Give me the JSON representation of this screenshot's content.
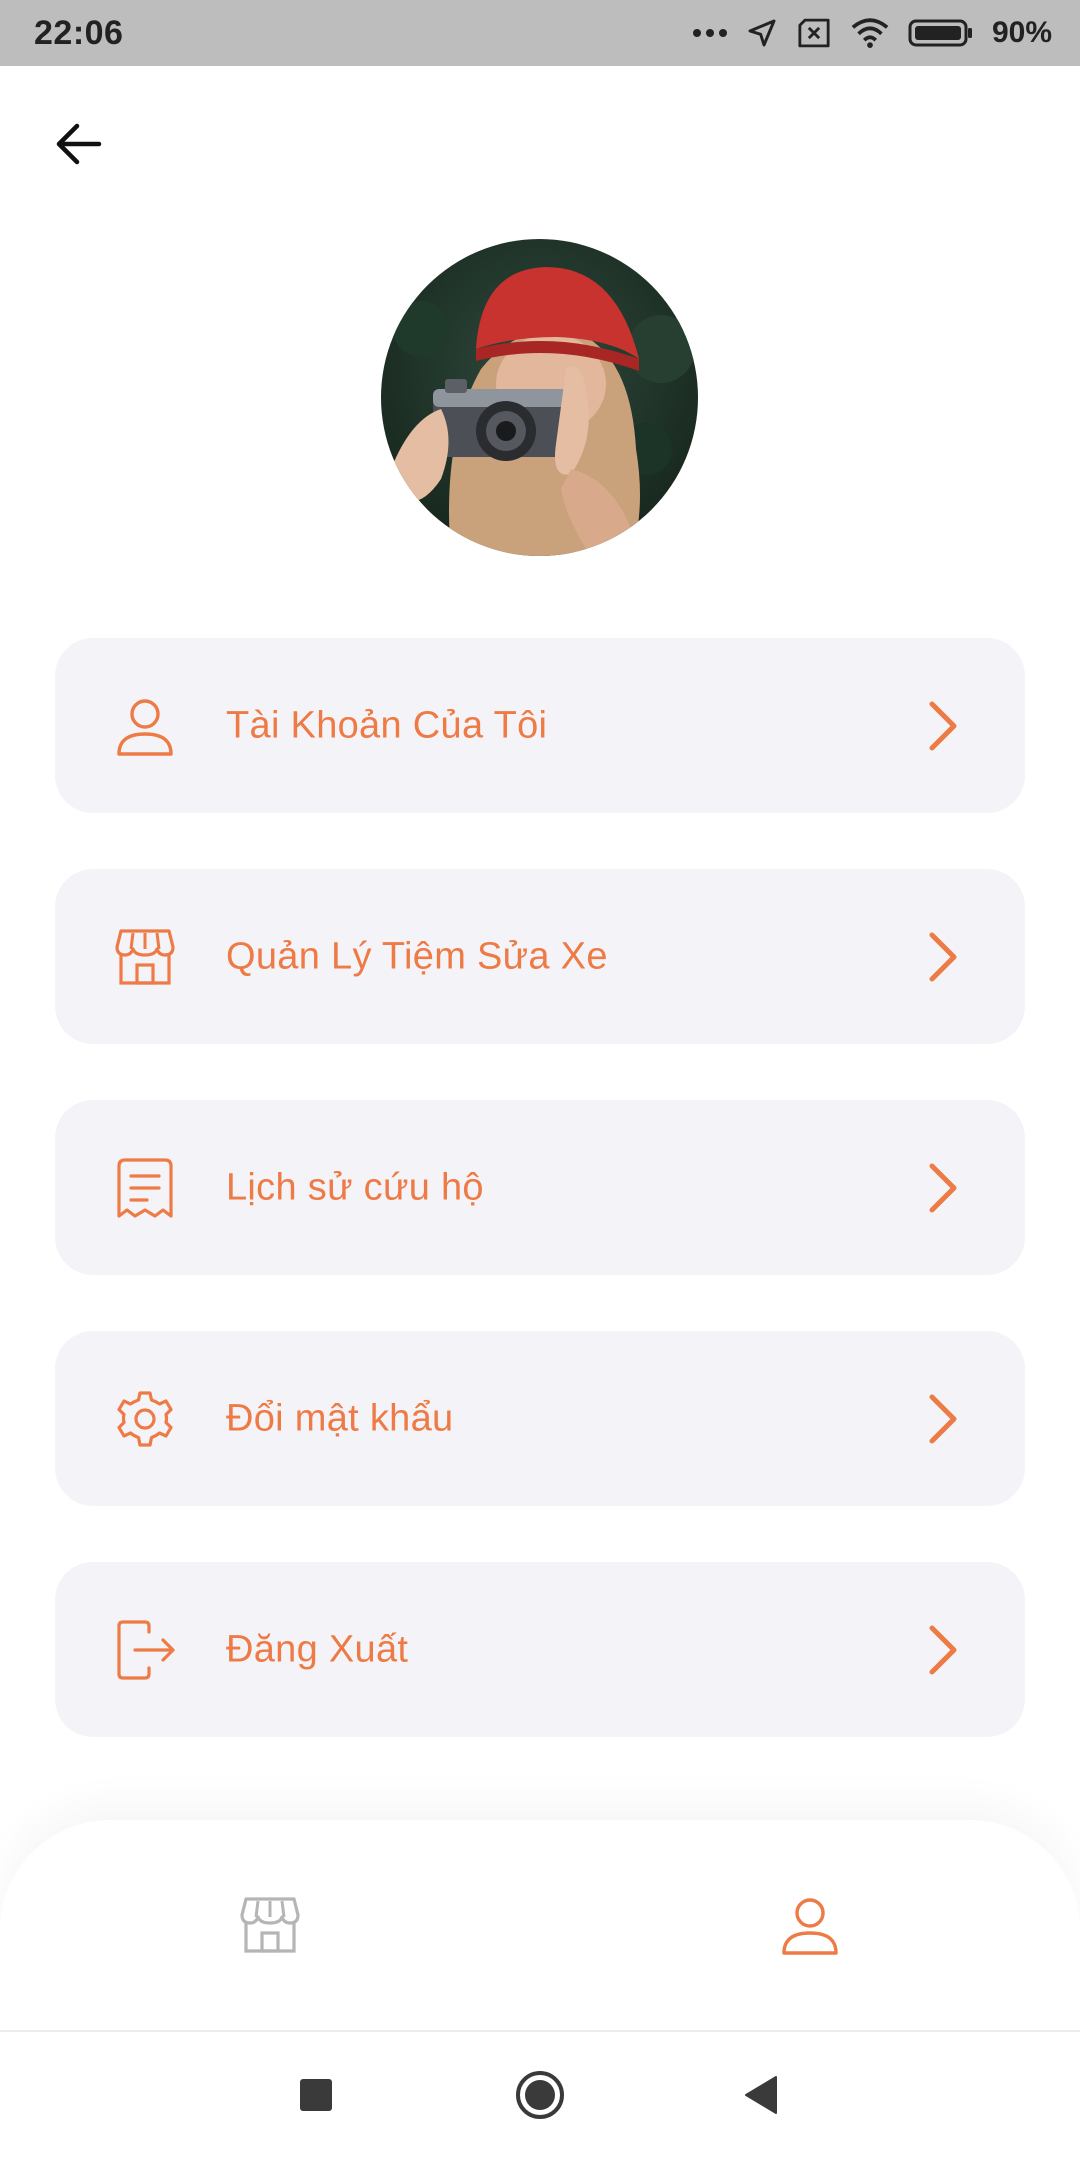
{
  "status_bar": {
    "time": "22:06",
    "battery": "90%",
    "icons": [
      "more-dots-icon",
      "location-arrow-icon",
      "sim-off-icon",
      "wifi-icon",
      "battery-icon"
    ]
  },
  "header": {
    "back_icon": "arrow-left-icon"
  },
  "profile": {
    "avatar_description": "profile-photo"
  },
  "menu": {
    "items": [
      {
        "label": "Tài Khoản Của Tôi",
        "icon": "user-icon"
      },
      {
        "label": "Quản Lý Tiệm Sửa Xe",
        "icon": "store-icon"
      },
      {
        "label": "Lịch sử cứu hộ",
        "icon": "receipt-icon"
      },
      {
        "label": "Đổi mật khẩu",
        "icon": "gear-icon"
      },
      {
        "label": "Đăng Xuất",
        "icon": "logout-icon"
      }
    ]
  },
  "bottom_nav": {
    "items": [
      {
        "icon": "store-icon",
        "active": false
      },
      {
        "icon": "user-icon",
        "active": true
      }
    ]
  },
  "colors": {
    "accent": "#ee7a45",
    "card_bg": "#f4f4f8",
    "status_bar_bg": "#bdbdbd",
    "inactive_icon": "#b5b5b5"
  }
}
